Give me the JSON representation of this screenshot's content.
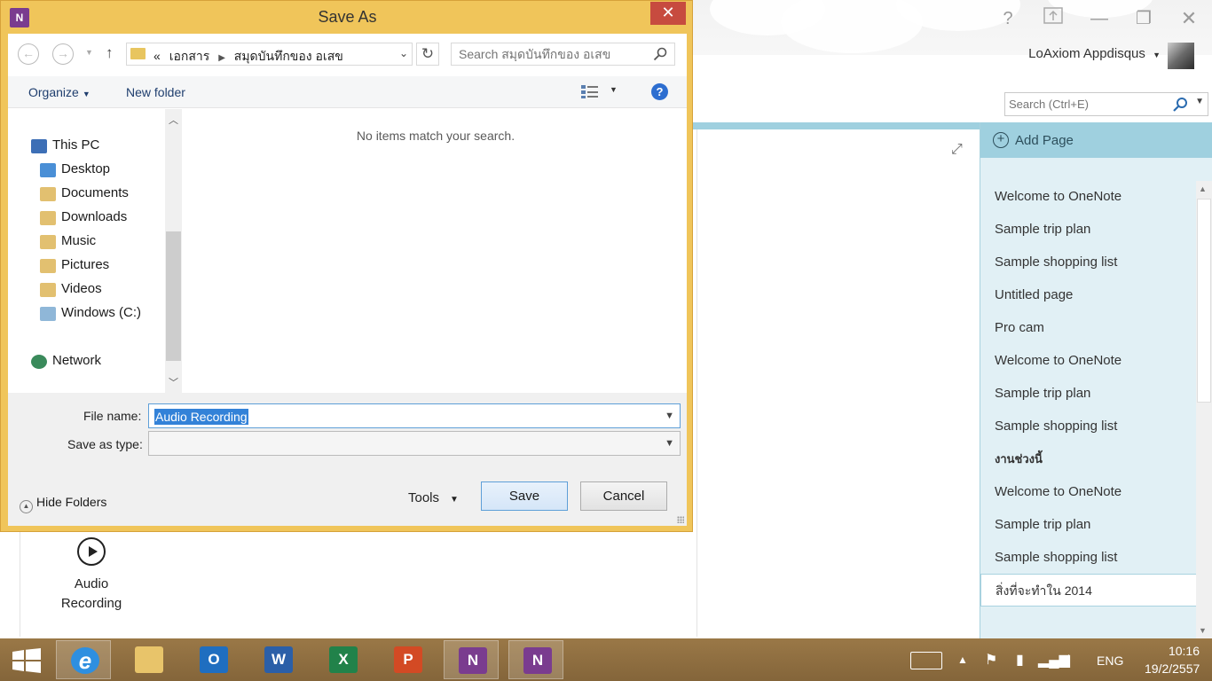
{
  "onenote": {
    "window_controls": [
      "?",
      "⇪",
      "—",
      "❐",
      "✕"
    ],
    "user_name": "LoAxiom Appdisqus",
    "search_placeholder": "Search (Ctrl+E)",
    "add_page_label": "Add Page",
    "pages": [
      {
        "label": "Welcome to OneNote",
        "style": "normal"
      },
      {
        "label": "Sample trip plan",
        "style": "normal"
      },
      {
        "label": "Sample shopping list",
        "style": "normal"
      },
      {
        "label": "Untitled page",
        "style": "normal"
      },
      {
        "label": "Pro cam",
        "style": "normal"
      },
      {
        "label": "Welcome to OneNote",
        "style": "normal"
      },
      {
        "label": "Sample trip plan",
        "style": "normal"
      },
      {
        "label": "Sample shopping list",
        "style": "normal"
      },
      {
        "label": "งานช่วงนี้",
        "style": "bold"
      },
      {
        "label": "Welcome to OneNote",
        "style": "normal"
      },
      {
        "label": "Sample trip plan",
        "style": "normal"
      },
      {
        "label": "Sample shopping list",
        "style": "normal"
      },
      {
        "label": "สิ่งที่จะทำใน 2014",
        "style": "selected"
      }
    ],
    "audio_label_line1": "Audio",
    "audio_label_line2": "Recording"
  },
  "dialog": {
    "title": "Save As",
    "app_icon_text": "N",
    "address": {
      "overflow": "«",
      "crumbs": [
        "เอกสาร",
        "สมุดบันทึกของ อเสข"
      ]
    },
    "search_placeholder": "Search สมุดบันทึกของ อเสข",
    "toolbar": {
      "organize_label": "Organize",
      "new_folder_label": "New folder",
      "help_label": "?"
    },
    "nav_tree": [
      {
        "label": "This PC",
        "icon": "computer-icon",
        "color": "#3d6fb6"
      },
      {
        "label": "Desktop",
        "icon": "desktop-folder-icon",
        "color": "#4a8fd6"
      },
      {
        "label": "Documents",
        "icon": "documents-folder-icon",
        "color": "#e2c070"
      },
      {
        "label": "Downloads",
        "icon": "downloads-folder-icon",
        "color": "#e2c070"
      },
      {
        "label": "Music",
        "icon": "music-folder-icon",
        "color": "#e2c070"
      },
      {
        "label": "Pictures",
        "icon": "pictures-folder-icon",
        "color": "#e2c070"
      },
      {
        "label": "Videos",
        "icon": "videos-folder-icon",
        "color": "#e2c070"
      },
      {
        "label": "Windows (C:)",
        "icon": "drive-icon",
        "color": "#8fb7d8"
      },
      {
        "label": "Network",
        "icon": "network-icon",
        "color": "#3a8a5b"
      }
    ],
    "empty_message": "No items match your search.",
    "file_name_label": "File name:",
    "file_name_value": "Audio Recording",
    "save_as_type_label": "Save as type:",
    "save_as_type_value": "",
    "hide_folders_label": "Hide Folders",
    "tools_label": "Tools",
    "save_label": "Save",
    "cancel_label": "Cancel"
  },
  "taskbar": {
    "apps": [
      {
        "name": "ie",
        "glyph": "e",
        "color": "#2e8fe0",
        "active": true
      },
      {
        "name": "file-explorer",
        "glyph": "",
        "color": "#e8c46a",
        "active": false
      },
      {
        "name": "outlook",
        "glyph": "O",
        "color": "#1f6ec0",
        "active": false
      },
      {
        "name": "word",
        "glyph": "W",
        "color": "#2b5fa8",
        "active": false
      },
      {
        "name": "excel",
        "glyph": "X",
        "color": "#21824a",
        "active": false
      },
      {
        "name": "powerpoint",
        "glyph": "P",
        "color": "#d34a24",
        "active": false
      },
      {
        "name": "onenote",
        "glyph": "N",
        "color": "#7a3c8f",
        "active": true
      },
      {
        "name": "onenote-clipping",
        "glyph": "N",
        "color": "#7a3c8f",
        "active": true
      }
    ],
    "language": "ENG",
    "time": "10:16",
    "date": "19/2/2557"
  }
}
